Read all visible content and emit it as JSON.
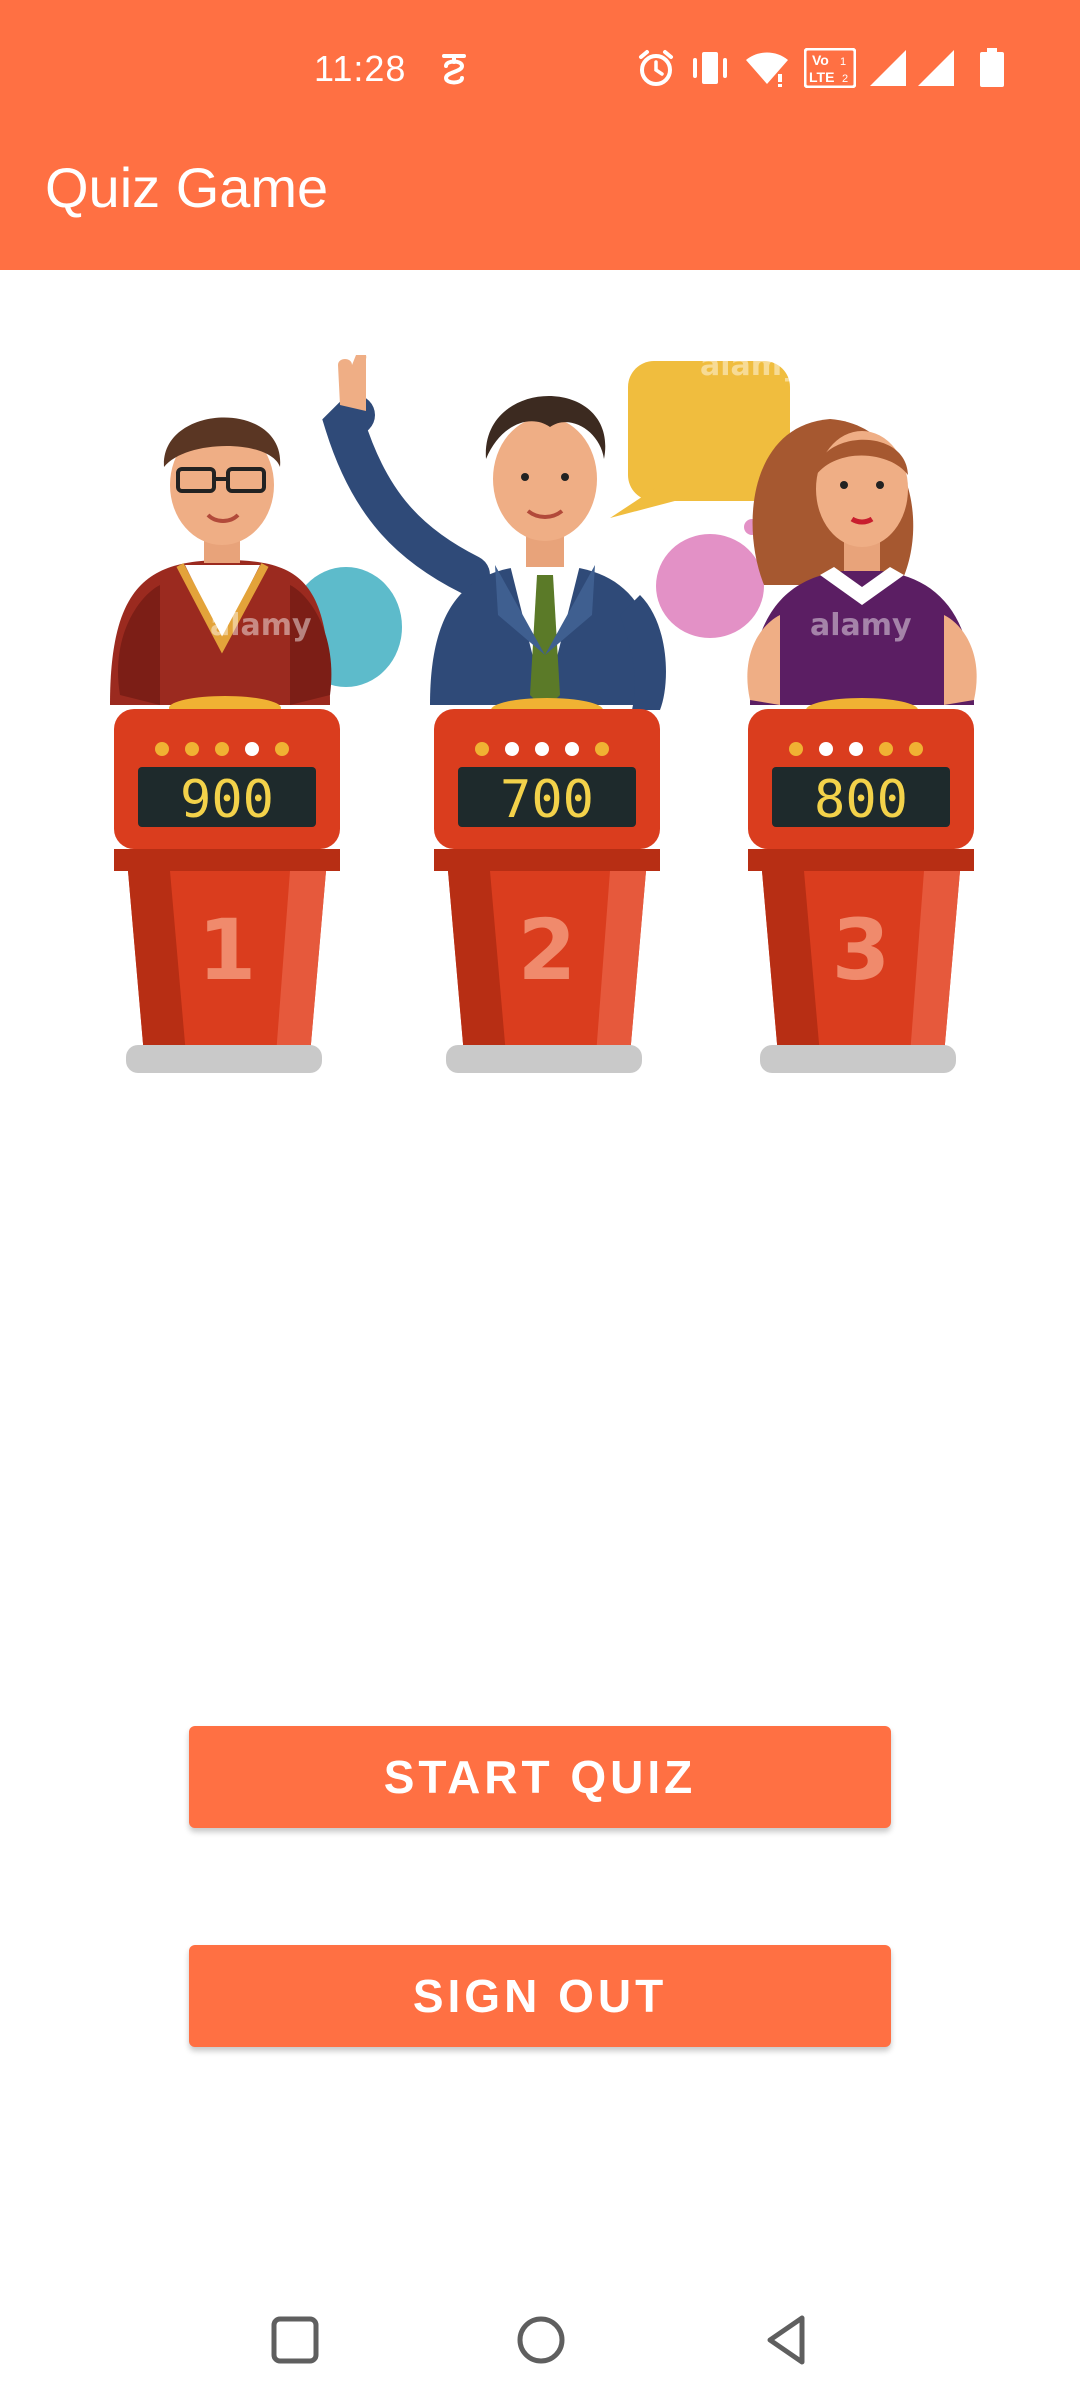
{
  "status_bar": {
    "time": "11:28",
    "icons": [
      "signal-s-icon",
      "alarm-icon",
      "vibrate-icon",
      "wifi-icon",
      "volte-icon",
      "cell-signal-icon",
      "cell-signal-2-icon",
      "battery-icon"
    ],
    "volte_top": "Vo",
    "volte_bottom": "LTE"
  },
  "app_bar": {
    "title": "Quiz Game"
  },
  "illustration": {
    "podiums": [
      {
        "score": "900",
        "number": "1"
      },
      {
        "score": "700",
        "number": "2"
      },
      {
        "score": "800",
        "number": "3"
      }
    ],
    "watermark": "alamy"
  },
  "buttons": {
    "start_label": "START QUIZ",
    "signout_label": "SIGN OUT"
  },
  "nav_bar": {
    "items": [
      "recents-icon",
      "home-icon",
      "back-icon"
    ]
  },
  "colors": {
    "accent": "#FF7043",
    "podium": "#DA3D1E",
    "display": "#1E2A2C",
    "digits": "#F3D24A"
  }
}
